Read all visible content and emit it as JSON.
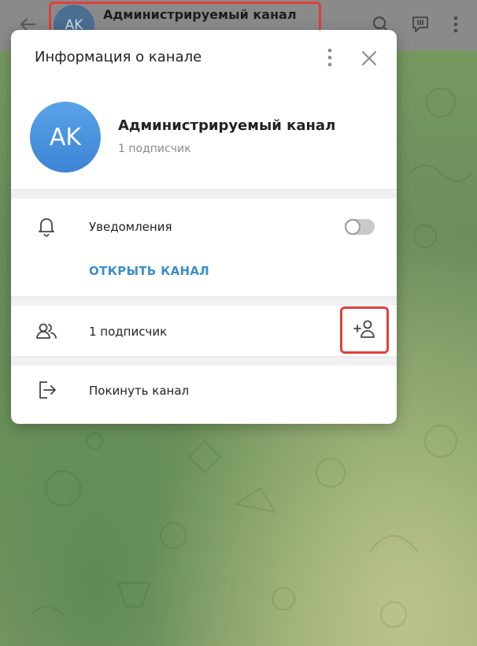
{
  "header": {
    "avatar_initials": "AK",
    "title": "Администрируемый канал"
  },
  "modal": {
    "title": "Информация о канале",
    "channel": {
      "avatar_initials": "AK",
      "name": "Администрируемый канал",
      "subscribers_text": "1 подписчик"
    },
    "notifications": {
      "label": "Уведомления",
      "enabled": false
    },
    "open_channel_label": "ОТКРЫТЬ КАНАЛ",
    "subscribers_row_label": "1 подписчик",
    "leave_label": "Покинуть канал"
  },
  "colors": {
    "accent": "#3a8fcc",
    "avatar": "#4a90e2",
    "highlight": "#e0403c"
  },
  "icons": {
    "back": "arrow-left-icon",
    "search": "search-icon",
    "discussion": "chat-icon",
    "header_more": "more-vertical-icon",
    "modal_more": "more-vertical-icon",
    "close": "close-icon",
    "notifications": "bell-icon",
    "subscribers": "users-icon",
    "add_subscriber": "add-user-icon",
    "leave": "leave-icon"
  }
}
